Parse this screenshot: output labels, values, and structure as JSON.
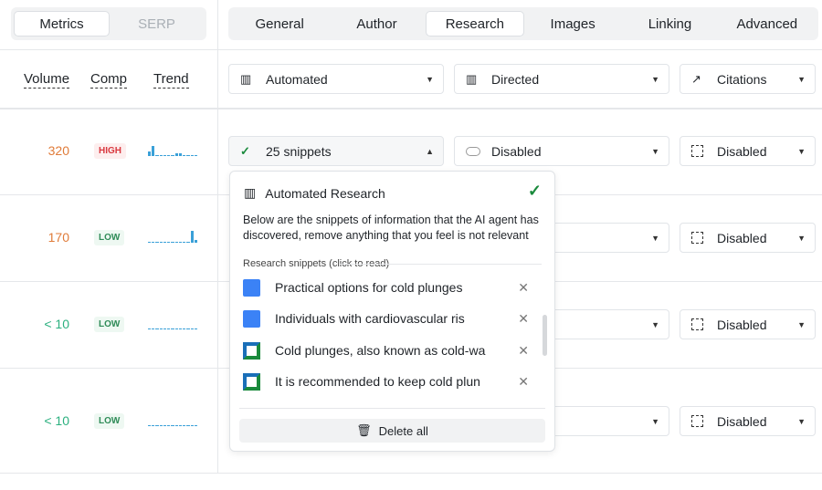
{
  "left_tabs": [
    "Metrics",
    "SERP"
  ],
  "top_tabs": [
    "General",
    "Author",
    "Research",
    "Images",
    "Linking",
    "Advanced"
  ],
  "columns": {
    "volume": "Volume",
    "comp": "Comp",
    "trend": "Trend"
  },
  "header_selects": {
    "automated": "Automated",
    "directed": "Directed",
    "citations": "Citations"
  },
  "rows": [
    {
      "volume": "320",
      "volume_color": "#e07b39",
      "comp": "HIGH",
      "research": "25 snippets",
      "directed": "Disabled",
      "citations": "Disabled"
    },
    {
      "volume": "170",
      "volume_color": "#e07b39",
      "comp": "LOW",
      "research": "",
      "directed": "",
      "citations": "Disabled"
    },
    {
      "volume": "< 10",
      "volume_color": "#2bb07f",
      "comp": "LOW",
      "research": "",
      "directed": "",
      "citations": "Disabled"
    },
    {
      "volume": "< 10",
      "volume_color": "#2bb07f",
      "comp": "LOW",
      "research": "",
      "directed": "",
      "citations": "Disabled"
    }
  ],
  "popup": {
    "title": "Automated Research",
    "description": "Below are the snippets of information that the AI agent has discovered, remove anything that you feel is not relevant",
    "section_label": "Research snippets (click to read)",
    "snippets": [
      "Practical options for cold plunges",
      "Individuals with cardiovascular ris",
      "Cold plunges, also known as cold-wa",
      "It is recommended to keep cold plun"
    ],
    "delete_all": "Delete all"
  }
}
